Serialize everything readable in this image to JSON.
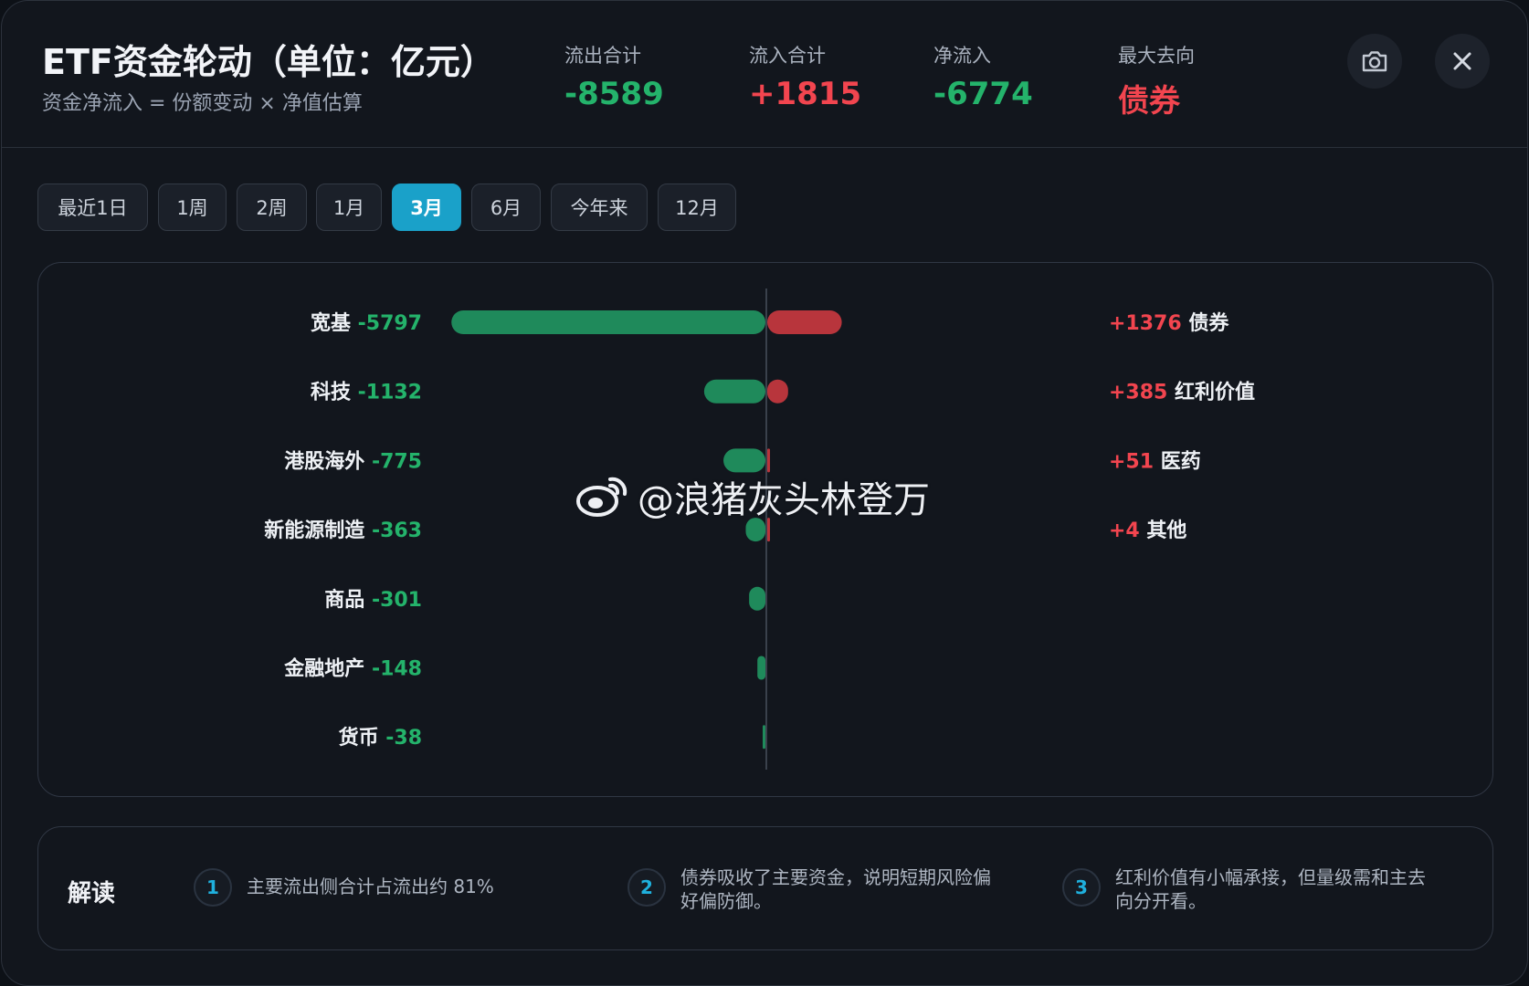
{
  "header": {
    "title": "ETF资金轮动（单位：亿元）",
    "subtitle": "资金净流入 = 份额变动 × 净值估算",
    "stats": [
      {
        "label": "流出合计",
        "value": "-8589",
        "color": "#24b36b"
      },
      {
        "label": "流入合计",
        "value": "+1815",
        "color": "#f2454f"
      },
      {
        "label": "净流入",
        "value": "-6774",
        "color": "#24b36b"
      },
      {
        "label": "最大去向",
        "value": "债券",
        "color": "#f2454f"
      }
    ],
    "camera_icon": "camera-icon",
    "close_icon": "close-icon"
  },
  "tabs": [
    "最近1日",
    "1周",
    "2周",
    "1月",
    "3月",
    "6月",
    "今年来",
    "12月"
  ],
  "active_tab": "3月",
  "colors": {
    "outflow_bar": "#1f8a5b",
    "inflow_bar": "#b8353c",
    "outflow_text": "#24b36b",
    "inflow_text": "#f2454f"
  },
  "chart_data": {
    "type": "bar",
    "orientation": "horizontal",
    "outflows": [
      {
        "category": "宽基",
        "value": -5797,
        "label": "-5797"
      },
      {
        "category": "科技",
        "value": -1132,
        "label": "-1132"
      },
      {
        "category": "港股海外",
        "value": -775,
        "label": "-775"
      },
      {
        "category": "新能源制造",
        "value": -363,
        "label": "-363"
      },
      {
        "category": "商品",
        "value": -301,
        "label": "-301"
      },
      {
        "category": "金融地产",
        "value": -148,
        "label": "-148"
      },
      {
        "category": "货币",
        "value": -38,
        "label": "-38"
      }
    ],
    "inflows": [
      {
        "category": "债券",
        "value": 1376,
        "label": "+1376"
      },
      {
        "category": "红利价值",
        "value": 385,
        "label": "+385"
      },
      {
        "category": "医药",
        "value": 51,
        "label": "+51"
      },
      {
        "category": "其他",
        "value": 4,
        "label": "+4"
      }
    ]
  },
  "watermark": "@浪猪灰头林登万",
  "notes": {
    "title": "解读",
    "items": [
      {
        "num": "1",
        "text": "主要流出侧合计占流出约 81%"
      },
      {
        "num": "2",
        "text": "债券吸收了主要资金，说明短期风险偏好偏防御。"
      },
      {
        "num": "3",
        "text": "红利价值有小幅承接，但量级需和主去向分开看。"
      }
    ]
  }
}
